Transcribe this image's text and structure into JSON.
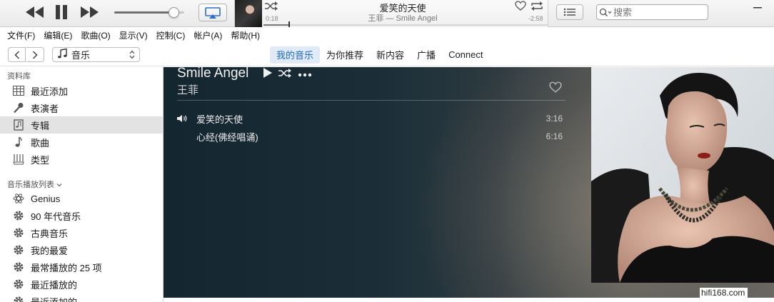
{
  "player": {
    "volume_level": 0.86,
    "now_playing": {
      "title": "爱笑的天使",
      "subtitle": "王菲 — Smile Angel",
      "elapsed": "0:18",
      "remaining": "-2:58",
      "progress": 0.09
    },
    "search": {
      "placeholder": "搜索"
    }
  },
  "menu": [
    "文件(F)",
    "编辑(E)",
    "歌曲(O)",
    "显示(V)",
    "控制(C)",
    "帐户(A)",
    "帮助(H)"
  ],
  "nav": {
    "source": "音乐",
    "tabs": [
      {
        "label": "我的音乐",
        "active": true
      },
      {
        "label": "为你推荐",
        "active": false
      },
      {
        "label": "新内容",
        "active": false
      },
      {
        "label": "广播",
        "active": false
      },
      {
        "label": "Connect",
        "active": false
      }
    ]
  },
  "sidebar": {
    "library_header": "资料库",
    "library_items": [
      {
        "label": "最近添加",
        "icon": "grid-icon"
      },
      {
        "label": "表演者",
        "icon": "microphone-icon"
      },
      {
        "label": "专辑",
        "icon": "album-icon",
        "selected": true
      },
      {
        "label": "歌曲",
        "icon": "note-icon"
      },
      {
        "label": "类型",
        "icon": "genre-icon"
      }
    ],
    "playlists_header": "音乐播放列表",
    "playlist_items": [
      {
        "label": "Genius",
        "icon": "genius-icon"
      },
      {
        "label": "90 年代音乐",
        "icon": "gear-icon"
      },
      {
        "label": "古典音乐",
        "icon": "gear-icon"
      },
      {
        "label": "我的最爱",
        "icon": "gear-icon"
      },
      {
        "label": "最常播放的 25 项",
        "icon": "gear-icon"
      },
      {
        "label": "最近播放的",
        "icon": "gear-icon"
      },
      {
        "label": "最近添加的",
        "icon": "gear-icon"
      }
    ]
  },
  "album": {
    "title": "Smile Angel",
    "artist": "王菲",
    "tracks": [
      {
        "name": "爱笑的天使",
        "duration": "3:16",
        "playing": true
      },
      {
        "name": "心经(佛经唱诵)",
        "duration": "6:16",
        "playing": false
      }
    ]
  },
  "watermark": "hifi168.com"
}
